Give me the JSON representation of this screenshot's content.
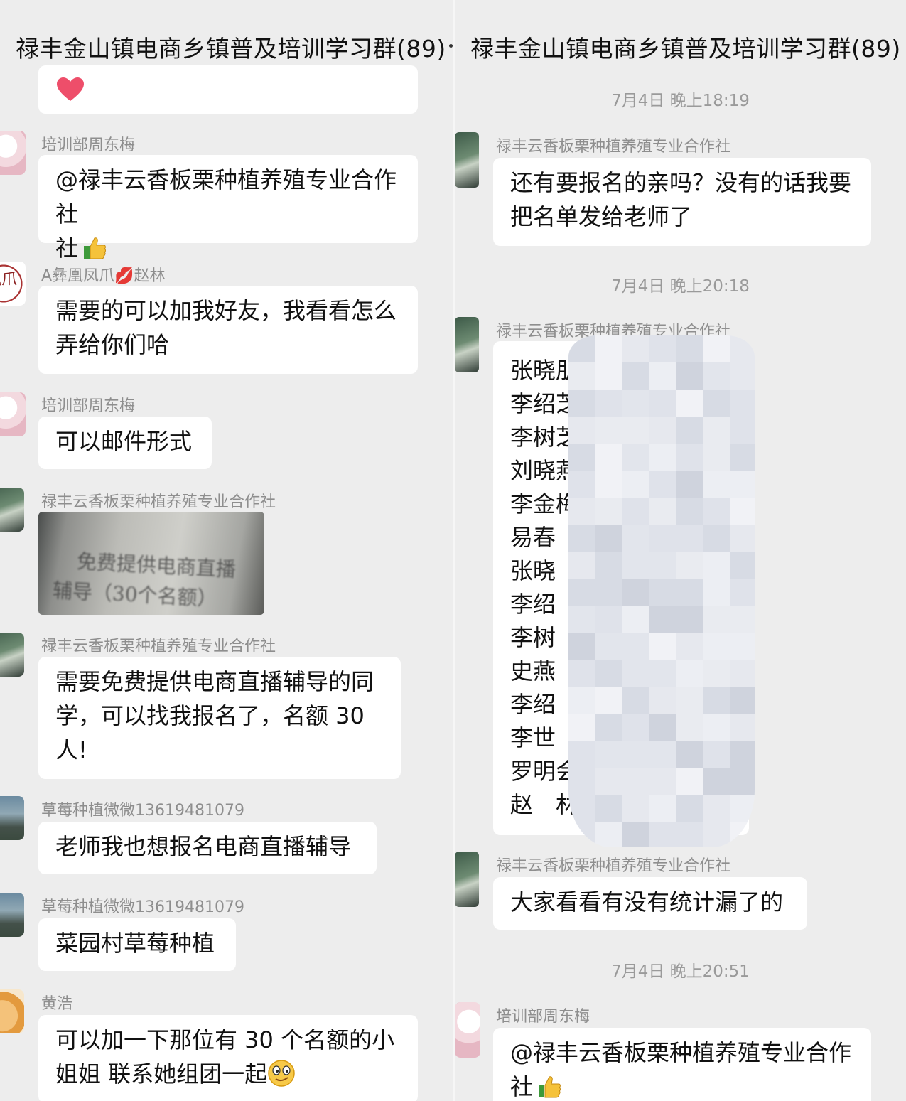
{
  "left": {
    "title": "禄丰金山镇电商乡镇普及培训学习群(89)",
    "messages": [
      {
        "sender": "培训部周东梅",
        "text": "@禄丰云香板栗种植养殖专业合作社",
        "text2": "社"
      },
      {
        "sender": "A彝凰凤爪💋赵林",
        "line1": "需要的可以加我好友，我看看怎么",
        "line2": "弄给你们哈"
      },
      {
        "sender": "培训部周东梅",
        "text": "可以邮件形式"
      },
      {
        "sender": "禄丰云香板栗种植养殖专业合作社",
        "photo_line1": "免费提供电商直播",
        "photo_line2": "辅导（30个名额）"
      },
      {
        "sender": "禄丰云香板栗种植养殖专业合作社",
        "line1": "需要免费提供电商直播辅导的同",
        "line2": "学，可以找我报名了，名额 30",
        "line3": "人!"
      },
      {
        "sender": "草莓种植微微13619481079",
        "text": "老师我也想报名电商直播辅导"
      },
      {
        "sender": "草莓种植微微13619481079",
        "text": "菜园村草莓种植"
      },
      {
        "sender": "黄浩",
        "line1": "可以加一下那位有 30 个名额的小",
        "line2": "姐姐 联系她组团一起"
      }
    ],
    "avatar_seal": "凰爪"
  },
  "right": {
    "title": "禄丰金山镇电商乡镇普及培训学习群(89)",
    "time1": "7月4日 晚上18:19",
    "msg1": {
      "sender": "禄丰云香板栗种植养殖专业合作社",
      "line1": "还有要报名的亲吗？没有的话我要",
      "line2": "把名单发给老师了"
    },
    "time2": "7月4日 晚上20:18",
    "msg2": {
      "sender": "禄丰云香板栗种植养殖专业合作社",
      "names": [
        "张晓朋",
        "李绍芝",
        "李树芝",
        "刘晓燕",
        "李金梅",
        "易春",
        "张晓",
        "李绍",
        "李树",
        "史燕",
        "李绍",
        "李世",
        "罗明会",
        "赵　林"
      ]
    },
    "msg3": {
      "sender": "禄丰云香板栗种植养殖专业合作社",
      "text": "大家看看有没有统计漏了的"
    },
    "time3": "7月4日 晚上20:51",
    "msg4": {
      "sender": "培训部周东梅",
      "line1": "@禄丰云香板栗种植养殖专业合作",
      "line2": "社"
    }
  }
}
